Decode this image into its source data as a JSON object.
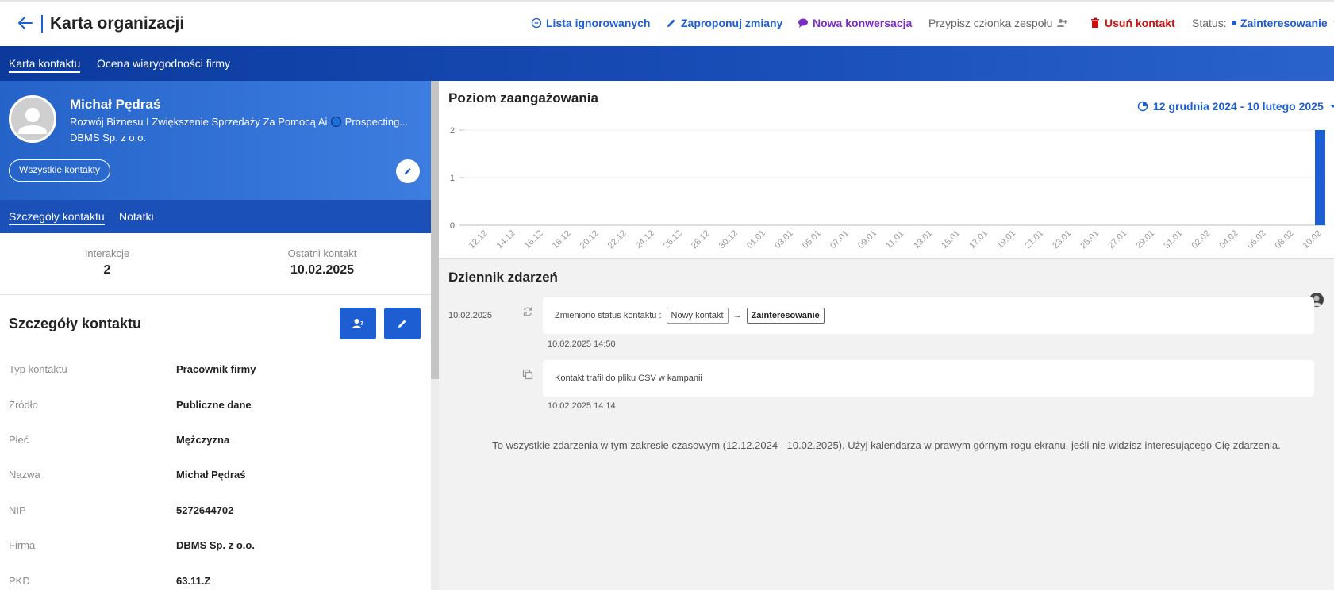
{
  "header": {
    "title": "Karta organizacji",
    "actions": {
      "ignored": "Lista ignorowanych",
      "propose": "Zaproponuj zmiany",
      "conversation": "Nowa konwersacja",
      "assign": "Przypisz członka zespołu",
      "delete": "Usuń kontakt",
      "status_label": "Status:",
      "status_value": "Zainteresowanie"
    }
  },
  "nav": {
    "tabs": [
      "Karta kontaktu",
      "Ocena wiarygodności firmy"
    ]
  },
  "profile": {
    "name": "Michał Pędraś",
    "headline_start": "Rozwój Biznesu I Zwiększenie Sprzedaży Za Pomocą Ai",
    "headline_end": "Prospecting...",
    "company": "DBMS Sp. z o.o.",
    "all_contacts": "Wszystkie kontakty",
    "subtabs": [
      "Szczegóły kontaktu",
      "Notatki"
    ]
  },
  "stats": {
    "interactions_label": "Interakcje",
    "interactions_value": "2",
    "last_contact_label": "Ostatni kontakt",
    "last_contact_value": "10.02.2025"
  },
  "details": {
    "title": "Szczegóły kontaktu",
    "rows": [
      {
        "label": "Typ kontaktu",
        "value": "Pracownik firmy"
      },
      {
        "label": "Źródło",
        "value": "Publiczne dane"
      },
      {
        "label": "Płeć",
        "value": "Mężczyzna"
      },
      {
        "label": "Nazwa",
        "value": "Michał Pędraś"
      },
      {
        "label": "NIP",
        "value": "5272644702"
      },
      {
        "label": "Firma",
        "value": "DBMS Sp. z o.o."
      },
      {
        "label": "PKD",
        "value": "63.11.Z"
      }
    ]
  },
  "engagement": {
    "title": "Poziom zaangażowania",
    "date_range": "12 grudnia 2024 - 10 lutego 2025"
  },
  "chart_data": {
    "type": "bar",
    "categories": [
      "12.12",
      "14.12",
      "16.12",
      "18.12",
      "20.12",
      "22.12",
      "24.12",
      "26.12",
      "28.12",
      "30.12",
      "01.01",
      "03.01",
      "05.01",
      "07.01",
      "09.01",
      "11.01",
      "13.01",
      "15.01",
      "17.01",
      "19.01",
      "21.01",
      "23.01",
      "25.01",
      "27.01",
      "29.01",
      "31.01",
      "02.02",
      "04.02",
      "06.02",
      "08.02",
      "10.02"
    ],
    "values": [
      0,
      0,
      0,
      0,
      0,
      0,
      0,
      0,
      0,
      0,
      0,
      0,
      0,
      0,
      0,
      0,
      0,
      0,
      0,
      0,
      0,
      0,
      0,
      0,
      0,
      0,
      0,
      0,
      0,
      0,
      2
    ],
    "yticks": [
      "0",
      "1",
      "2"
    ],
    "ylim": [
      0,
      2
    ],
    "grid": true,
    "bar_color": "#1e5ed3"
  },
  "journal": {
    "title": "Dziennik zdarzeń",
    "date": "10.02.2025",
    "events": [
      {
        "text": "Zmieniono status kontaktu :",
        "from": "Nowy kontakt",
        "arrow": "→",
        "to": "Zainteresowanie",
        "time": "10.02.2025 14:50"
      },
      {
        "text": "Kontakt trafił do pliku CSV w kampanii",
        "time": "10.02.2025 14:14"
      }
    ],
    "footer": "To wszystkie zdarzenia w tym zakresie czasowym (12.12.2024 - 10.02.2025). Użyj kalendarza w prawym górnym rogu ekranu, jeśli nie widzisz interesującego Cię zdarzenia."
  }
}
